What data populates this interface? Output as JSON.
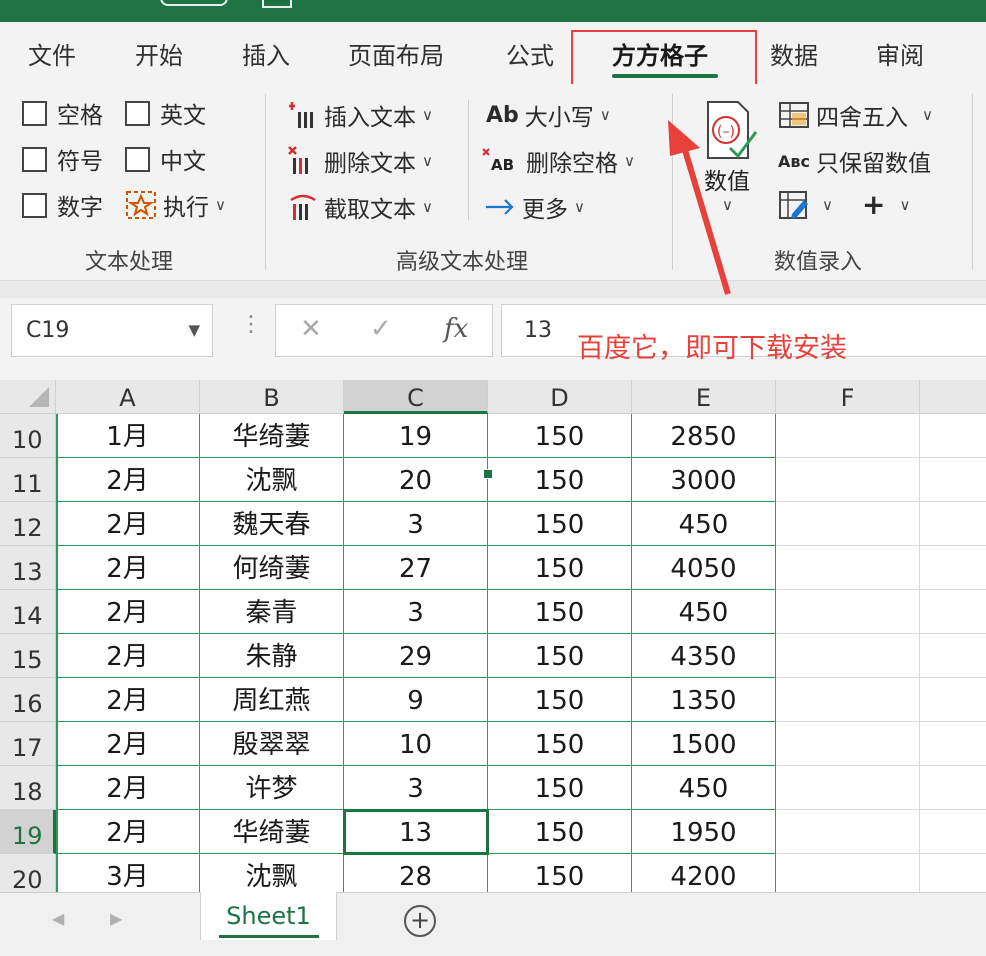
{
  "menu": {
    "tabs": [
      "文件",
      "开始",
      "插入",
      "页面布局",
      "公式",
      "方方格子",
      "数据",
      "审阅"
    ],
    "active_tab": "方方格子"
  },
  "ribbon": {
    "text_group": {
      "label": "文本处理",
      "checkboxes": [
        "空格",
        "英文",
        "符号",
        "中文",
        "数字"
      ],
      "execute": "执行"
    },
    "advanced_group": {
      "label": "高级文本处理",
      "insert_text": "插入文本",
      "delete_text": "删除文本",
      "extract_text": "截取文本",
      "case": "大小写",
      "delete_spaces": "删除空格",
      "more": "更多"
    },
    "numeric_group": {
      "label": "数值录入",
      "numeric": "数值",
      "round": "四舍五入",
      "keep_numeric": "只保留数值"
    }
  },
  "formula_bar": {
    "name_box": "C19",
    "value": "13",
    "fx": "fx"
  },
  "annotation": "百度它，即可下载安装",
  "grid": {
    "columns": [
      "A",
      "B",
      "C",
      "D",
      "E",
      "F"
    ],
    "rows": [
      {
        "num": "10",
        "cells": [
          "1月",
          "华绮萋",
          "19",
          "150",
          "2850"
        ]
      },
      {
        "num": "11",
        "cells": [
          "2月",
          "沈飘",
          "20",
          "150",
          "3000"
        ]
      },
      {
        "num": "12",
        "cells": [
          "2月",
          "魏天春",
          "3",
          "150",
          "450"
        ]
      },
      {
        "num": "13",
        "cells": [
          "2月",
          "何绮萋",
          "27",
          "150",
          "4050"
        ]
      },
      {
        "num": "14",
        "cells": [
          "2月",
          "秦青",
          "3",
          "150",
          "450"
        ]
      },
      {
        "num": "15",
        "cells": [
          "2月",
          "朱静",
          "29",
          "150",
          "4350"
        ]
      },
      {
        "num": "16",
        "cells": [
          "2月",
          "周红燕",
          "9",
          "150",
          "1350"
        ]
      },
      {
        "num": "17",
        "cells": [
          "2月",
          "殷翠翠",
          "10",
          "150",
          "1500"
        ]
      },
      {
        "num": "18",
        "cells": [
          "2月",
          "许梦",
          "3",
          "150",
          "450"
        ]
      },
      {
        "num": "19",
        "cells": [
          "2月",
          "华绮萋",
          "13",
          "150",
          "1950"
        ]
      },
      {
        "num": "20",
        "cells": [
          "3月",
          "沈飘",
          "28",
          "150",
          "4200"
        ]
      }
    ],
    "active_row": "19",
    "active_col": "C"
  },
  "sheets": {
    "tabs": [
      "Sheet1"
    ],
    "add": "+"
  },
  "colors": {
    "accent": "#1f7244",
    "annotation": "#e8403a"
  }
}
